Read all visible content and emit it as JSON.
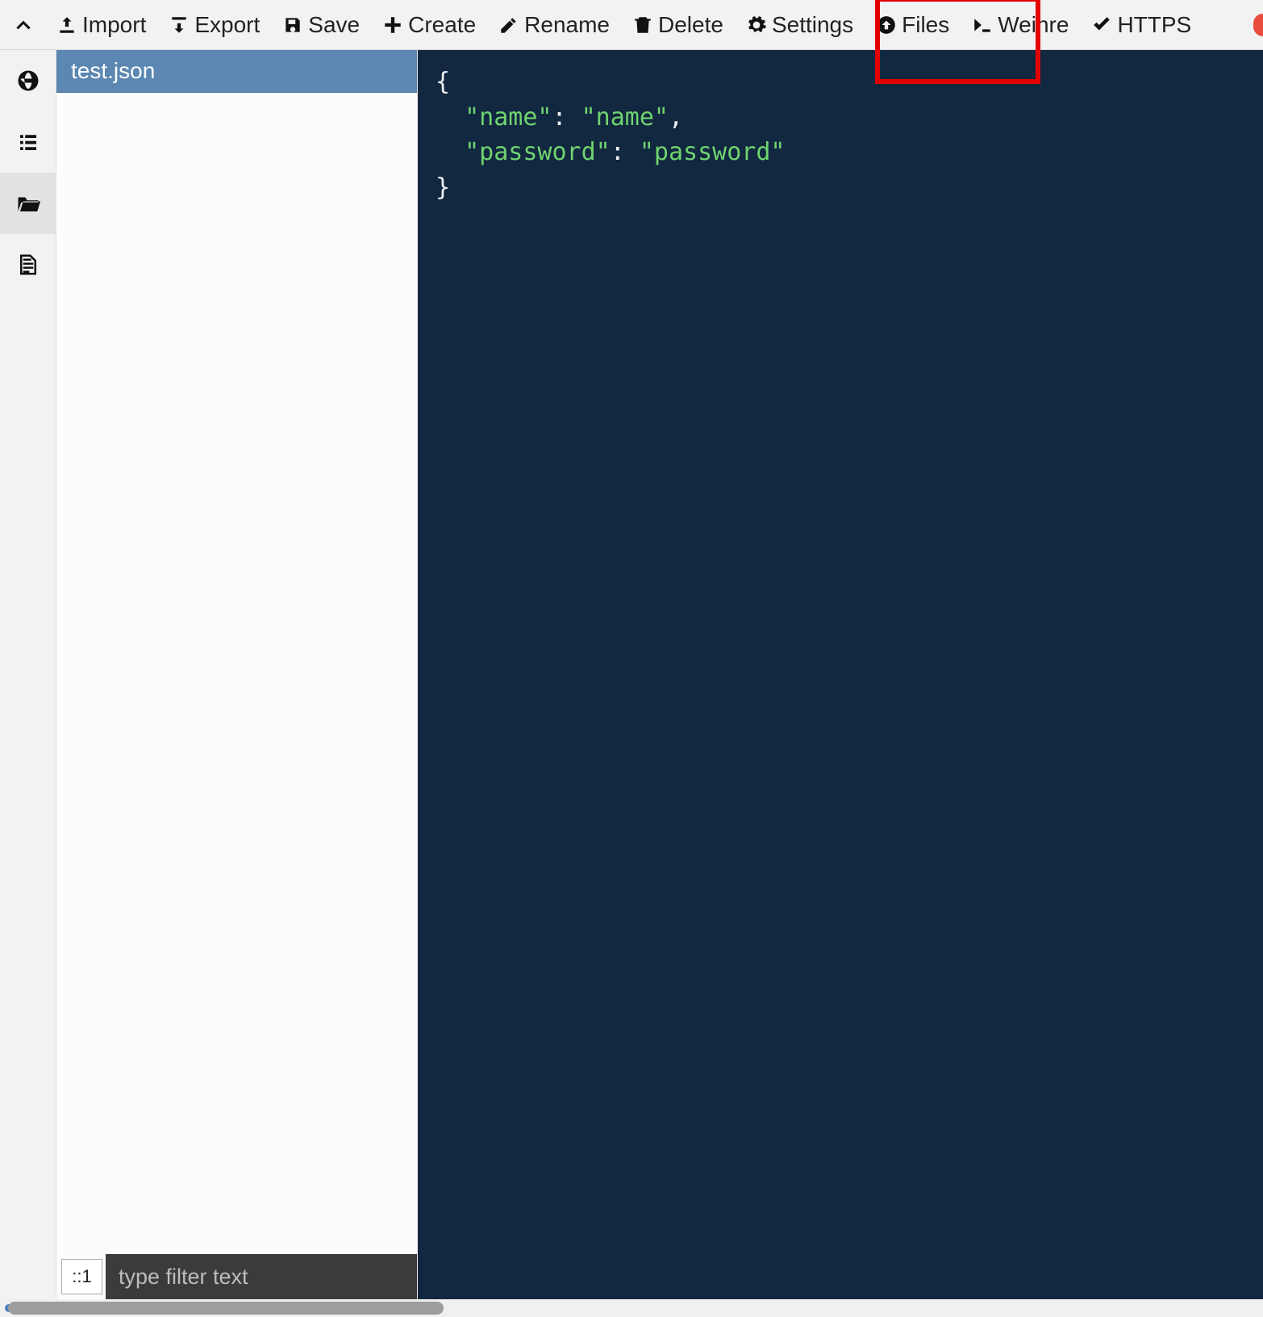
{
  "toolbar": {
    "import_label": "Import",
    "export_label": "Export",
    "save_label": "Save",
    "create_label": "Create",
    "rename_label": "Rename",
    "delete_label": "Delete",
    "settings_label": "Settings",
    "files_label": "Files",
    "weinre_label": "Weinre",
    "https_label": "HTTPS"
  },
  "sidebar": {
    "items": [
      "globe",
      "list",
      "folder-open",
      "document"
    ],
    "active_index": 2
  },
  "file_tree": {
    "items": [
      {
        "name": "test.json",
        "selected": true
      }
    ]
  },
  "filter": {
    "badge": "::1",
    "placeholder": "type filter text"
  },
  "editor": {
    "language": "json",
    "content_keys": {
      "k1": "\"name\"",
      "v1": "\"name\"",
      "k2": "\"password\"",
      "v2": "\"password\""
    },
    "braces": {
      "open": "{",
      "close": "}"
    },
    "punct": {
      "colon": ":",
      "comma": ","
    }
  }
}
